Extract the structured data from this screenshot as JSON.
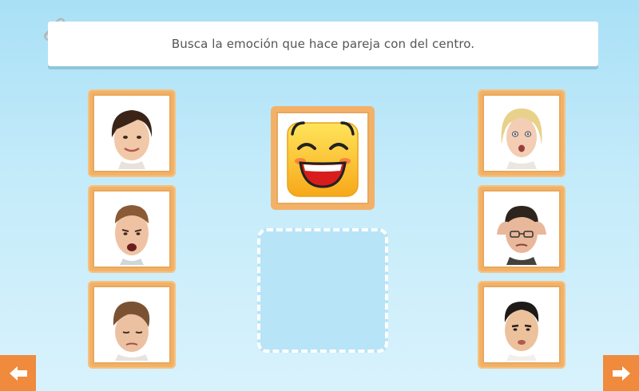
{
  "instruction": {
    "text": "Busca la emoción que hace pareja con del centro."
  },
  "icons": {
    "attach": "paperclip-icon",
    "prev": "arrow-left-icon",
    "next": "arrow-right-icon"
  },
  "center": {
    "emotion_icon": "laughing-emoji"
  },
  "left_cards": [
    {
      "face": "smiling-woman"
    },
    {
      "face": "shouting-boy"
    },
    {
      "face": "sad-young-man"
    }
  ],
  "right_cards": [
    {
      "face": "surprised-woman"
    },
    {
      "face": "stressed-man-headache"
    },
    {
      "face": "pouting-man"
    }
  ],
  "colors": {
    "card_orange": "#f3b167",
    "nav_orange": "#f08a3c",
    "background": "#c4ebfa",
    "dropzone": "#b8e4f8"
  }
}
